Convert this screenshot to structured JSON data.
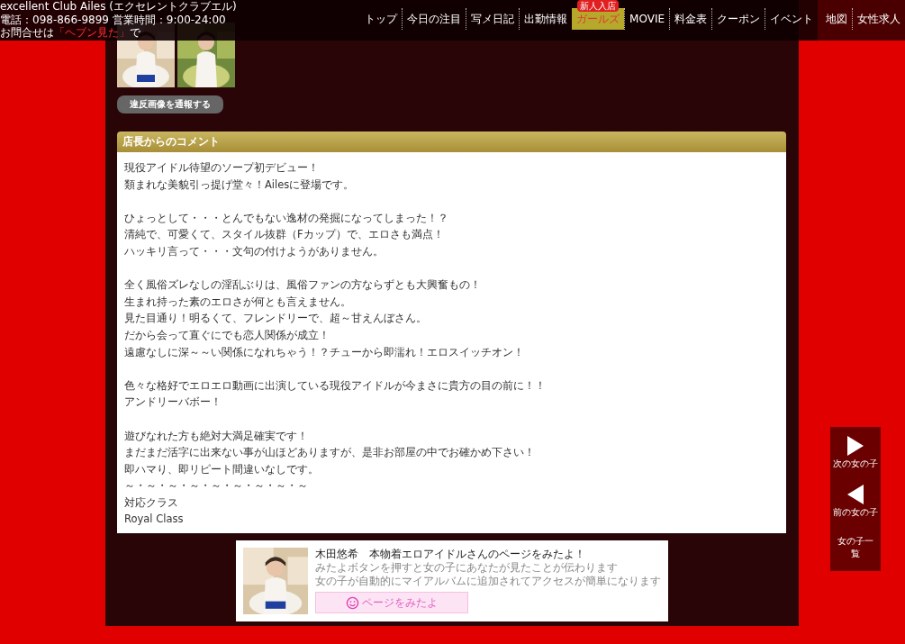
{
  "header": {
    "shop_name": "excellent Club Ailes (エクセレントクラブエル)",
    "contact": "電話：098-866-9899 営業時間：9:00-24:00",
    "inquiry_prefix": "お問合せは",
    "inquiry_highlight": "「ヘブン見た」",
    "inquiry_suffix": "で"
  },
  "nav": [
    {
      "label": "トップ",
      "selected": false
    },
    {
      "label": "今日の注目",
      "selected": false
    },
    {
      "label": "写メ日記",
      "selected": false
    },
    {
      "label": "出勤情報",
      "selected": false
    },
    {
      "label": "ガールズ",
      "selected": true,
      "badge": "新人入店"
    },
    {
      "label": "MOVIE",
      "selected": false
    },
    {
      "label": "料金表",
      "selected": false
    },
    {
      "label": "クーポン",
      "selected": false
    },
    {
      "label": "イベント",
      "selected": false
    }
  ],
  "recruit_nav": [
    {
      "label": "地図",
      "selected": false
    },
    {
      "label": "女性求人",
      "selected": false
    }
  ],
  "report_button": "違反画像を通報する",
  "comment": {
    "title": "店長からのコメント",
    "paragraphs": [
      [
        "現役アイドル待望のソープ初デビュー！",
        "類まれな美貌引っ提げ堂々！Ailesに登場です。"
      ],
      [
        "ひょっとして・・・とんでもない逸材の発掘になってしまった！？",
        "清純で、可愛くて、スタイル抜群（Fカップ）で、エロさも満点！",
        "ハッキリ言って・・・文句の付けようがありません。"
      ],
      [
        "全く風俗ズレなしの淫乱ぶりは、風俗ファンの方ならずとも大興奮もの！",
        "生まれ持った素のエロさが何とも言えません。",
        "見た目通り！明るくて、フレンドリーで、超～甘えんぼさん。",
        "だから会って直ぐにでも恋人関係が成立！",
        "遠慮なしに深～～い関係になれちゃう！？チューから即濡れ！エロスイッチオン！"
      ],
      [
        "色々な格好でエロエロ動画に出演している現役アイドルが今まさに貴方の目の前に！！",
        "アンドリーバボー！"
      ],
      [
        "遊びなれた方も絶対大満足確実です！",
        "まだまだ活字に出来ない事が山ほどありますが、是非お部屋の中でお確かめ下さい！",
        "即ハマり、即リピート間違いなしです。",
        "～・～・～・～・～・～・～・～・～",
        "対応クラス",
        "Royal Class"
      ]
    ]
  },
  "mitayo": {
    "title": "木田悠希　本物着エロアイドルさんのページをみたよ！",
    "description": [
      "みたよボタンを押すと女の子にあなたが見たことが伝わります",
      "女の子が自動的にマイアルバムに追加されてアクセスが簡単になります"
    ],
    "button": "ページをみたよ"
  },
  "side_nav": [
    {
      "kind": "next",
      "label": "次の女の子"
    },
    {
      "kind": "prev",
      "label": "前の女の子"
    },
    {
      "kind": "list",
      "label": "女の子一覧"
    }
  ]
}
